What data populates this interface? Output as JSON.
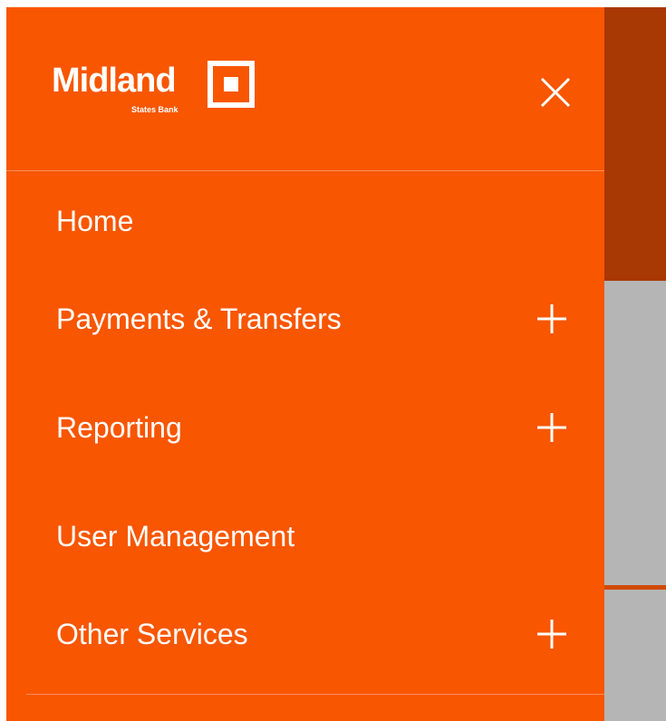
{
  "logo": {
    "name": "Midland",
    "tagline": "States Bank"
  },
  "icons": {
    "close": "close-icon",
    "expand": "plus-icon",
    "logo_mark": "square-logo-icon"
  },
  "colors": {
    "drawer": "#f85600",
    "overlay_header": "#a83804",
    "overlay_content": "#b5b5b5",
    "text": "#ffffff"
  },
  "menu": {
    "items": [
      {
        "label": "Home",
        "expandable": false
      },
      {
        "label": "Payments & Transfers",
        "expandable": true
      },
      {
        "label": "Reporting",
        "expandable": true
      },
      {
        "label": "User Management",
        "expandable": false
      },
      {
        "label": "Other Services",
        "expandable": true
      }
    ]
  }
}
